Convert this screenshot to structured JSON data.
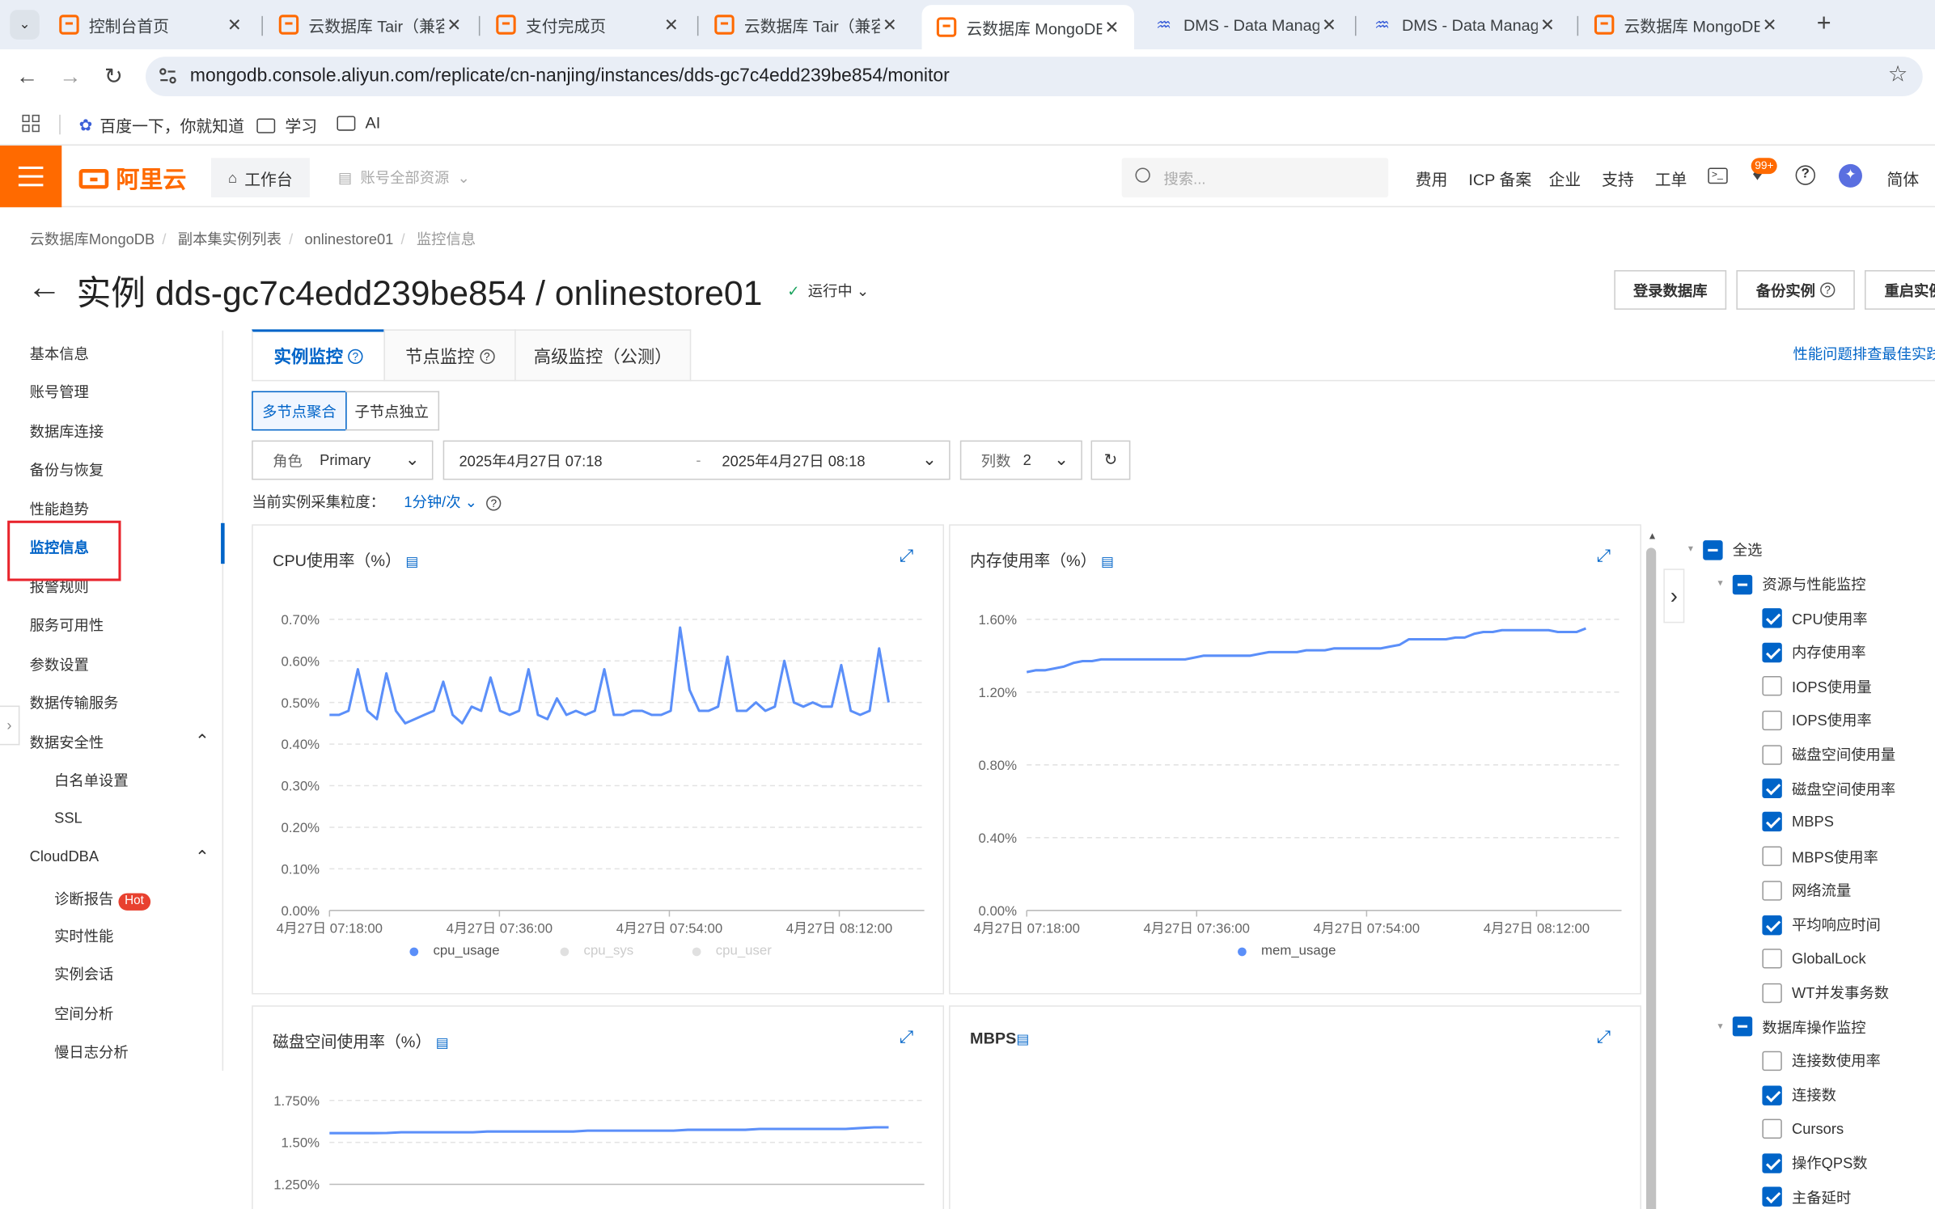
{
  "browser": {
    "tabs": [
      {
        "title": "控制台首页",
        "icon": "aliyun"
      },
      {
        "title": "云数据库 Tair（兼容",
        "icon": "aliyun"
      },
      {
        "title": "支付完成页",
        "icon": "aliyun"
      },
      {
        "title": "云数据库 Tair（兼容",
        "icon": "aliyun"
      },
      {
        "title": "云数据库 MongoDB",
        "icon": "aliyun",
        "active": true
      },
      {
        "title": "DMS - Data Manag",
        "icon": "dms"
      },
      {
        "title": "DMS - Data Manag",
        "icon": "dms"
      },
      {
        "title": "云数据库 MongoDB",
        "icon": "aliyun"
      }
    ],
    "url": "mongodb.console.aliyun.com/replicate/cn-nanjing/instances/dds-gc7c4edd239be854/monitor",
    "bookmarks": [
      "百度一下，你就知道",
      "学习",
      "AI"
    ]
  },
  "header": {
    "logo": "阿里云",
    "workbench": "工作台",
    "resources": "账号全部资源",
    "search_placeholder": "搜索...",
    "links": [
      "费用",
      "ICP 备案",
      "企业",
      "支持",
      "工单"
    ],
    "badge": "99+",
    "lang": "简体"
  },
  "breadcrumb": [
    "云数据库MongoDB",
    "副本集实例列表",
    "onlinestore01",
    "监控信息"
  ],
  "title": "实例 dds-gc7c4edd239be854 / onlinestore01",
  "status": "运行中",
  "actions": [
    "登录数据库",
    "备份实例",
    "重启实例"
  ],
  "sidebar": {
    "items": [
      "基本信息",
      "账号管理",
      "数据库连接",
      "备份与恢复",
      "性能趋势",
      "监控信息",
      "报警规则",
      "服务可用性",
      "参数设置",
      "数据传输服务"
    ],
    "security": {
      "label": "数据安全性",
      "children": [
        "白名单设置",
        "SSL"
      ]
    },
    "clouddba": {
      "label": "CloudDBA",
      "children": [
        "诊断报告",
        "实时性能",
        "实例会话",
        "空间分析",
        "慢日志分析"
      ],
      "hot": "Hot"
    }
  },
  "tabs": [
    "实例监控",
    "节点监控",
    "高级监控（公测）"
  ],
  "best_practice_link": "性能问题排查最佳实践",
  "segments": [
    "多节点聚合",
    "子节点独立"
  ],
  "filters": {
    "role_label": "角色",
    "role_value": "Primary",
    "start": "2025年4月27日 07:18",
    "end": "2025年4月27日 08:18",
    "cols_label": "列数",
    "cols_value": "2"
  },
  "granularity": {
    "label": "当前实例采集粒度：",
    "value": "1分钟/次"
  },
  "charts": [
    {
      "title": "CPU使用率（%）",
      "legend": [
        "cpu_usage",
        "cpu_sys",
        "cpu_user"
      ],
      "legend_colors": [
        "#5b8ff9",
        "#d8d8d8",
        "#d8d8d8"
      ]
    },
    {
      "title": "内存使用率（%）",
      "legend": [
        "mem_usage"
      ],
      "legend_colors": [
        "#5b8ff9"
      ]
    },
    {
      "title": "磁盘空间使用率（%）"
    },
    {
      "title": "MBPS"
    }
  ],
  "chart_data": [
    {
      "type": "line",
      "title": "CPU使用率（%）",
      "x_ticks": [
        "4月27日 07:18:00",
        "4月27日 07:36:00",
        "4月27日 07:54:00",
        "4月27日 08:12:00"
      ],
      "y_ticks": [
        "0.00%",
        "0.10%",
        "0.20%",
        "0.30%",
        "0.40%",
        "0.50%",
        "0.60%",
        "0.70%"
      ],
      "ylim": [
        0,
        0.7
      ],
      "series": [
        {
          "name": "cpu_usage",
          "values": [
            0.47,
            0.47,
            0.48,
            0.58,
            0.48,
            0.46,
            0.57,
            0.48,
            0.45,
            0.46,
            0.47,
            0.48,
            0.55,
            0.47,
            0.45,
            0.49,
            0.48,
            0.56,
            0.48,
            0.47,
            0.48,
            0.58,
            0.47,
            0.46,
            0.51,
            0.47,
            0.48,
            0.47,
            0.48,
            0.58,
            0.47,
            0.47,
            0.48,
            0.48,
            0.47,
            0.47,
            0.48,
            0.68,
            0.53,
            0.48,
            0.48,
            0.49,
            0.61,
            0.48,
            0.48,
            0.5,
            0.48,
            0.49,
            0.6,
            0.5,
            0.49,
            0.5,
            0.49,
            0.49,
            0.59,
            0.48,
            0.47,
            0.48,
            0.63,
            0.5
          ]
        }
      ]
    },
    {
      "type": "line",
      "title": "内存使用率（%）",
      "x_ticks": [
        "4月27日 07:18:00",
        "4月27日 07:36:00",
        "4月27日 07:54:00",
        "4月27日 08:12:00"
      ],
      "y_ticks": [
        "0.00%",
        "0.40%",
        "0.80%",
        "1.20%",
        "1.60%"
      ],
      "ylim": [
        0,
        1.6
      ],
      "series": [
        {
          "name": "mem_usage",
          "values": [
            1.31,
            1.32,
            1.32,
            1.33,
            1.34,
            1.36,
            1.37,
            1.37,
            1.38,
            1.38,
            1.38,
            1.38,
            1.38,
            1.38,
            1.38,
            1.38,
            1.38,
            1.38,
            1.39,
            1.4,
            1.4,
            1.4,
            1.4,
            1.4,
            1.4,
            1.41,
            1.42,
            1.42,
            1.42,
            1.42,
            1.43,
            1.43,
            1.43,
            1.44,
            1.44,
            1.44,
            1.44,
            1.44,
            1.44,
            1.45,
            1.46,
            1.49,
            1.49,
            1.49,
            1.49,
            1.49,
            1.5,
            1.5,
            1.52,
            1.53,
            1.53,
            1.54,
            1.54,
            1.54,
            1.54,
            1.54,
            1.54,
            1.53,
            1.53,
            1.53,
            1.55
          ]
        }
      ]
    },
    {
      "type": "line",
      "title": "磁盘空间使用率（%）",
      "y_ticks": [
        "1.250%",
        "1.50%",
        "1.750%"
      ],
      "ylim": [
        1.25,
        1.75
      ],
      "series": [
        {
          "name": "",
          "values": [
            1.555,
            1.555,
            1.555,
            1.555,
            1.556,
            1.56,
            1.56,
            1.56,
            1.56,
            1.56,
            1.56,
            1.565,
            1.565,
            1.565,
            1.565,
            1.565,
            1.565,
            1.565,
            1.57,
            1.57,
            1.57,
            1.57,
            1.57,
            1.57,
            1.57,
            1.575,
            1.575,
            1.575,
            1.575,
            1.575,
            1.58,
            1.58,
            1.58,
            1.58,
            1.58,
            1.58,
            1.58,
            1.585,
            1.59,
            1.59
          ]
        }
      ]
    }
  ],
  "metric_panel": {
    "all": "全选",
    "groups": [
      {
        "label": "资源与性能监控",
        "items": [
          {
            "label": "CPU使用率",
            "checked": true
          },
          {
            "label": "内存使用率",
            "checked": true
          },
          {
            "label": "IOPS使用量",
            "checked": false
          },
          {
            "label": "IOPS使用率",
            "checked": false
          },
          {
            "label": "磁盘空间使用量",
            "checked": false
          },
          {
            "label": "磁盘空间使用率",
            "checked": true
          },
          {
            "label": "MBPS",
            "checked": true
          },
          {
            "label": "MBPS使用率",
            "checked": false
          },
          {
            "label": "网络流量",
            "checked": false
          },
          {
            "label": "平均响应时间",
            "checked": true
          },
          {
            "label": "GlobalLock",
            "checked": false
          },
          {
            "label": "WT并发事务数",
            "checked": false
          }
        ]
      },
      {
        "label": "数据库操作监控",
        "items": [
          {
            "label": "连接数使用率",
            "checked": false
          },
          {
            "label": "连接数",
            "checked": true
          },
          {
            "label": "Cursors",
            "checked": false
          },
          {
            "label": "操作QPS数",
            "checked": true
          },
          {
            "label": "主备延时",
            "checked": true
          }
        ]
      }
    ]
  },
  "colors": {
    "accent": "#0064c8",
    "brand": "#ff6a00",
    "line": "#5b8ff9",
    "highlight": "#e8242c"
  }
}
